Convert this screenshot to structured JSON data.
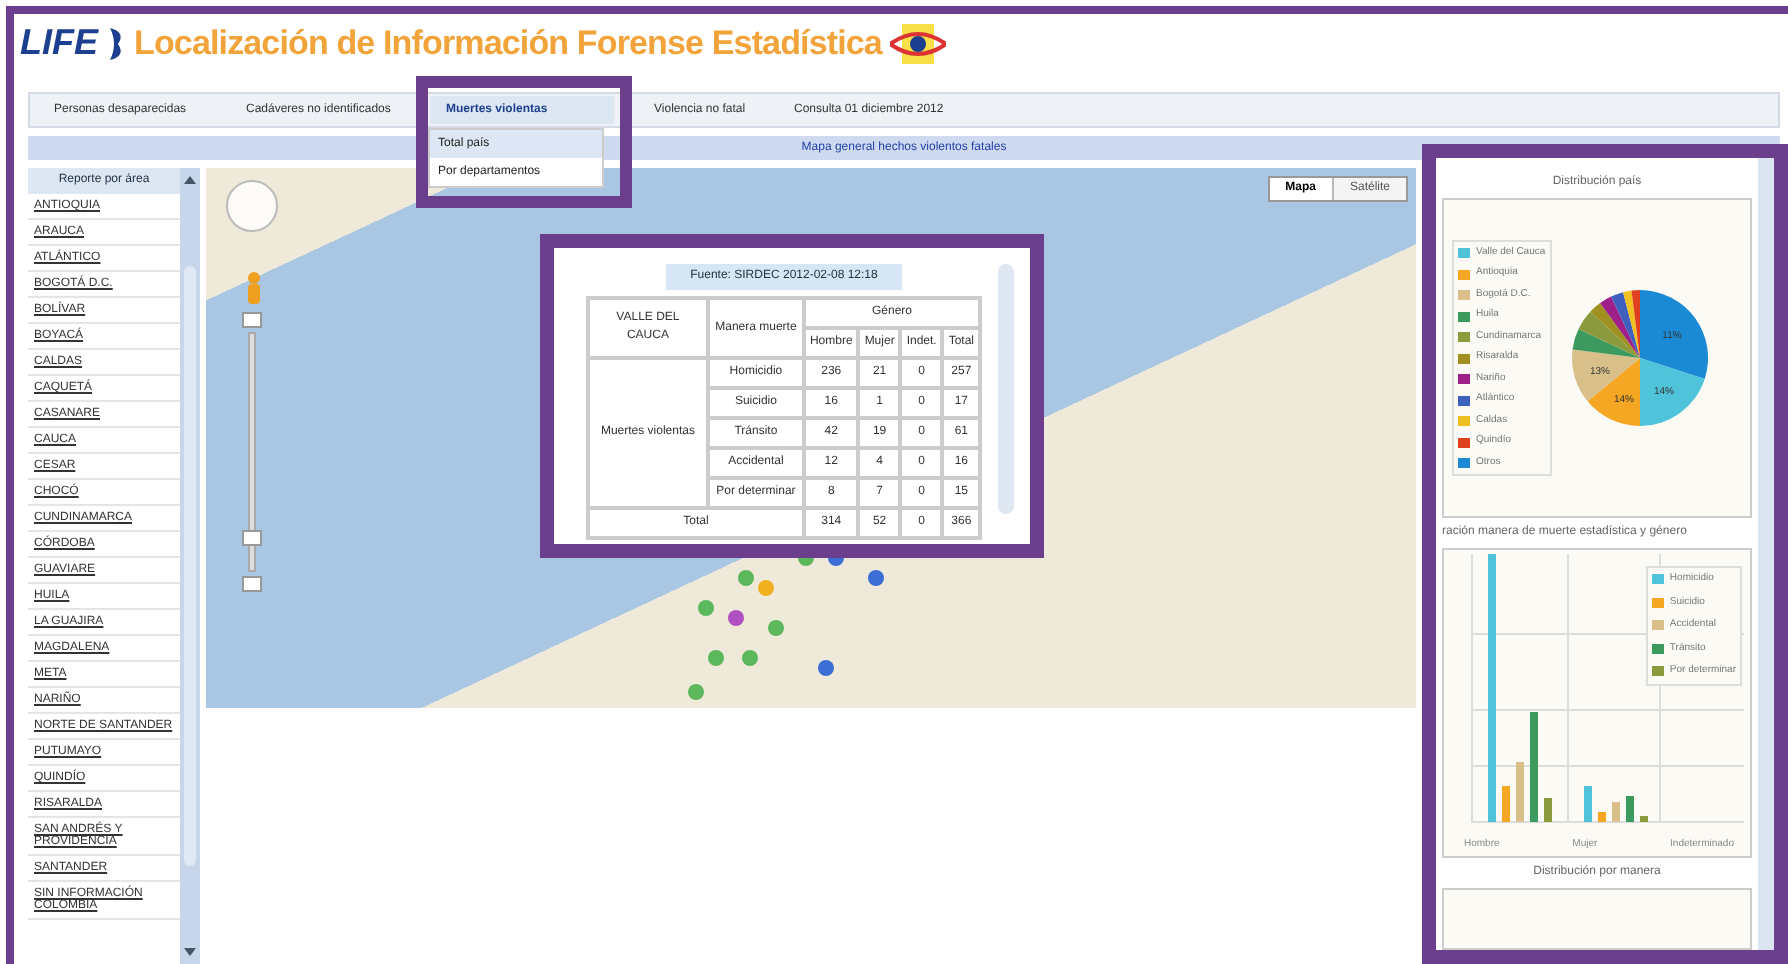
{
  "header": {
    "logo": "LIFE",
    "title": "Localización de Información Forense Estadística"
  },
  "nav": [
    {
      "label": "Personas desaparecidas",
      "selected": false
    },
    {
      "label": "Cadáveres no identificados",
      "selected": false
    },
    {
      "label": "Muertes violentas",
      "selected": true
    },
    {
      "label": "Violencia no fatal",
      "selected": false
    },
    {
      "label": "Consulta 01 diciembre 2012",
      "selected": false
    }
  ],
  "dropdown": [
    {
      "label": "Total país",
      "selected": true
    },
    {
      "label": "Por departamentos",
      "selected": false
    }
  ],
  "banner": "Mapa general hechos violentos fatales",
  "sidebar": {
    "title": "Reporte por área",
    "items": [
      "ANTIOQUIA",
      "ARAUCA",
      "ATLÁNTICO",
      "BOGOTÁ D.C.",
      "BOLÍVAR",
      "BOYACÁ",
      "CALDAS",
      "CAQUETÁ",
      "CASANARE",
      "CAUCA",
      "CESAR",
      "CHOCÓ",
      "CUNDINAMARCA",
      "CÓRDOBA",
      "GUAVIARE",
      "HUILA",
      "LA GUAJIRA",
      "MAGDALENA",
      "META",
      "NARIÑO",
      "NORTE DE SANTANDER",
      "PUTUMAYO",
      "QUINDÍO",
      "RISARALDA",
      "SAN ANDRÉS Y PROVIDENCIA",
      "SANTANDER",
      "SIN INFORMACIÓN COLOMBIA"
    ]
  },
  "map": {
    "zoom": {
      "level": 0.12
    },
    "types": [
      {
        "label": "Mapa",
        "selected": true
      },
      {
        "label": "Satélite",
        "selected": false
      }
    ]
  },
  "popup": {
    "source": "Fuente: SIRDEC 2012-02-08 12:18",
    "region": "VALLE DEL CAUCA",
    "manner_header": "Manera muerte",
    "gender_header": "Género",
    "genders": [
      "Hombre",
      "Mujer",
      "Indet.",
      "Total"
    ],
    "group": "Muertes violentas",
    "rows": [
      {
        "label": "Homicidio",
        "values": [
          "236",
          "21",
          "0",
          "257"
        ]
      },
      {
        "label": "Suicidio",
        "values": [
          "16",
          "1",
          "0",
          "17"
        ]
      },
      {
        "label": "Tránsito",
        "values": [
          "42",
          "19",
          "0",
          "61"
        ]
      },
      {
        "label": "Accidental",
        "values": [
          "12",
          "4",
          "0",
          "16"
        ]
      },
      {
        "label": "Por determinar",
        "values": [
          "8",
          "7",
          "0",
          "15"
        ]
      }
    ],
    "total": {
      "label": "Total",
      "values": [
        "314",
        "52",
        "0",
        "366"
      ]
    }
  },
  "right_panel": {
    "pie_title": "Distribución país",
    "pie_legend": [
      {
        "label": "Valle del Cauca",
        "color": "#4fc3d9"
      },
      {
        "label": "Antioquia",
        "color": "#f5a623"
      },
      {
        "label": "Bogotá D.C.",
        "color": "#d9c08a"
      },
      {
        "label": "Huila",
        "color": "#3c9a5f"
      },
      {
        "label": "Cundinamarca",
        "color": "#8a9a3c"
      },
      {
        "label": "Risaralda",
        "color": "#a09020"
      },
      {
        "label": "Nariño",
        "color": "#a0208a"
      },
      {
        "label": "Atlántico",
        "color": "#4060c0"
      },
      {
        "label": "Caldas",
        "color": "#f0c020"
      },
      {
        "label": "Quindío",
        "color": "#e04020"
      },
      {
        "label": "Otros",
        "color": "#1a8ad4"
      }
    ],
    "pie_labels": [
      "11%",
      "14%",
      "14%",
      "13%"
    ],
    "bar_title": "ración manera de muerte estadística y género",
    "bar_legend": [
      {
        "label": "Homicidio",
        "color": "#4fc3d9"
      },
      {
        "label": "Suicidio",
        "color": "#f5a623"
      },
      {
        "label": "Accidental",
        "color": "#d9c08a"
      },
      {
        "label": "Tránsito",
        "color": "#3c9a5f"
      },
      {
        "label": "Por determinar",
        "color": "#8a9a3c"
      }
    ],
    "bar_categories": [
      "Hombre",
      "Mujer",
      "Indeterminado"
    ],
    "bottom_title": "Distribución por manera"
  }
}
